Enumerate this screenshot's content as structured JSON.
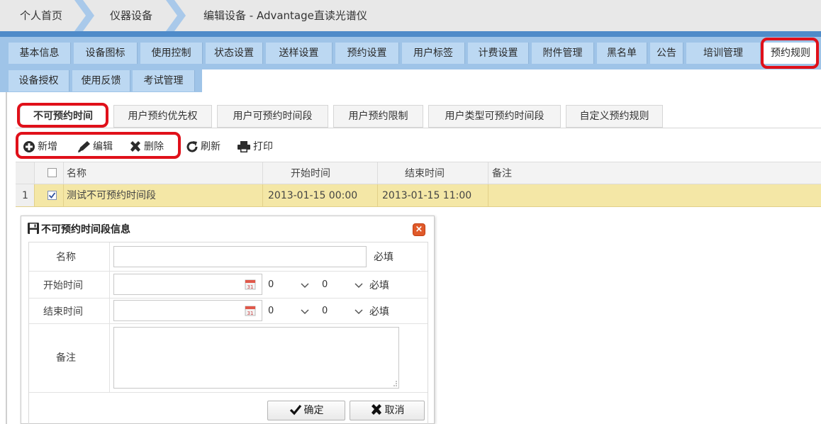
{
  "breadcrumb": {
    "home": "个人首页",
    "section": "仪器设备",
    "current": "编辑设备 - Advantage直读光谱仪"
  },
  "main_tabs_row1": [
    "基本信息",
    "设备图标",
    "使用控制",
    "状态设置",
    "送样设置",
    "预约设置",
    "用户标签",
    "计费设置",
    "附件管理",
    "黑名单",
    "公告",
    "培训管理",
    "预约规则"
  ],
  "main_tabs_row2": [
    "设备授权",
    "使用反馈",
    "考试管理"
  ],
  "active_main_tab": "预约规则",
  "sub_tabs": [
    "不可预约时间",
    "用户预约优先权",
    "用户可预约时间段",
    "用户预约限制",
    "用户类型可预约时间段",
    "自定义预约规则"
  ],
  "active_sub_tab": "不可预约时间",
  "toolbar": {
    "add": "新增",
    "edit": "编辑",
    "delete": "删除",
    "refresh": "刷新",
    "print": "打印"
  },
  "grid": {
    "columns": [
      "名称",
      "开始时间",
      "结束时间",
      "备注"
    ],
    "rows": [
      {
        "index": "1",
        "checked": true,
        "name": "测试不可预约时间段",
        "start": "2013-01-15 00:00",
        "end": "2013-01-15 11:00",
        "note": ""
      }
    ]
  },
  "dialog": {
    "title": "不可预约时间段信息",
    "close": "×",
    "fields": {
      "name_label": "名称",
      "name_value": "",
      "start_label": "开始时间",
      "start_date": "",
      "start_hour": "0",
      "start_minute": "0",
      "end_label": "结束时间",
      "end_date": "",
      "end_hour": "0",
      "end_minute": "0",
      "note_label": "备注",
      "note_value": "",
      "required": "必填"
    },
    "ok": "确定",
    "cancel": "取消"
  },
  "colors": {
    "stripe": "#4f8bc9",
    "tab_bar": "#9fc4e8",
    "tab_bg": "#bcd8f2",
    "highlight": "#e0101a",
    "selected_row": "#f4e7a6"
  }
}
